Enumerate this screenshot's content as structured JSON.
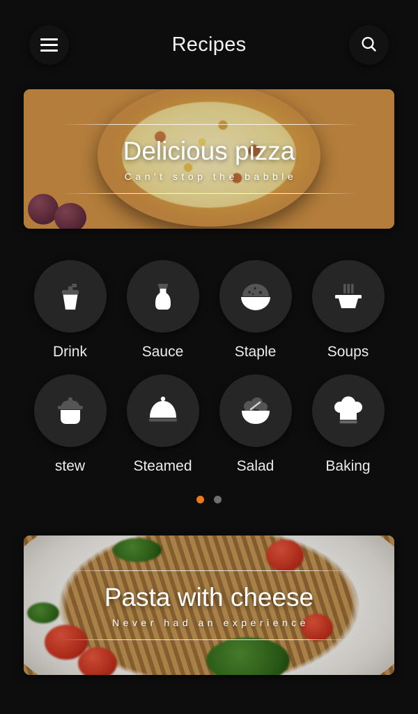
{
  "header": {
    "title": "Recipes",
    "menu_icon": "hamburger-menu-icon",
    "search_icon": "search-icon"
  },
  "hero_banner": {
    "title": "Delicious pizza",
    "subtitle": "Can't stop the babble",
    "image_desc": "pizza-on-cooling-rack-photo"
  },
  "categories": [
    {
      "label": "Drink",
      "icon": "drink-cup-icon"
    },
    {
      "label": "Sauce",
      "icon": "sauce-bottle-icon"
    },
    {
      "label": "Staple",
      "icon": "rice-bowl-icon"
    },
    {
      "label": "Soups",
      "icon": "soup-bowl-icon"
    },
    {
      "label": "stew",
      "icon": "stew-pot-icon"
    },
    {
      "label": "Steamed",
      "icon": "cloche-dome-icon"
    },
    {
      "label": "Salad",
      "icon": "salad-bowl-icon"
    },
    {
      "label": "Baking",
      "icon": "chef-hat-icon"
    }
  ],
  "pagination": {
    "total": 2,
    "active_index": 0,
    "active_color": "#f07818",
    "inactive_color": "#6e6e6e"
  },
  "bottom_banner": {
    "title": "Pasta with cheese",
    "subtitle": "Never had an experience",
    "image_desc": "pasta-with-tomato-and-greens-photo"
  },
  "theme": {
    "background": "#0d0d0d",
    "circle_background": "#262626",
    "text_primary": "#ececec",
    "icon_white": "#ffffff",
    "icon_gray": "#555555",
    "accent": "#f07818"
  }
}
